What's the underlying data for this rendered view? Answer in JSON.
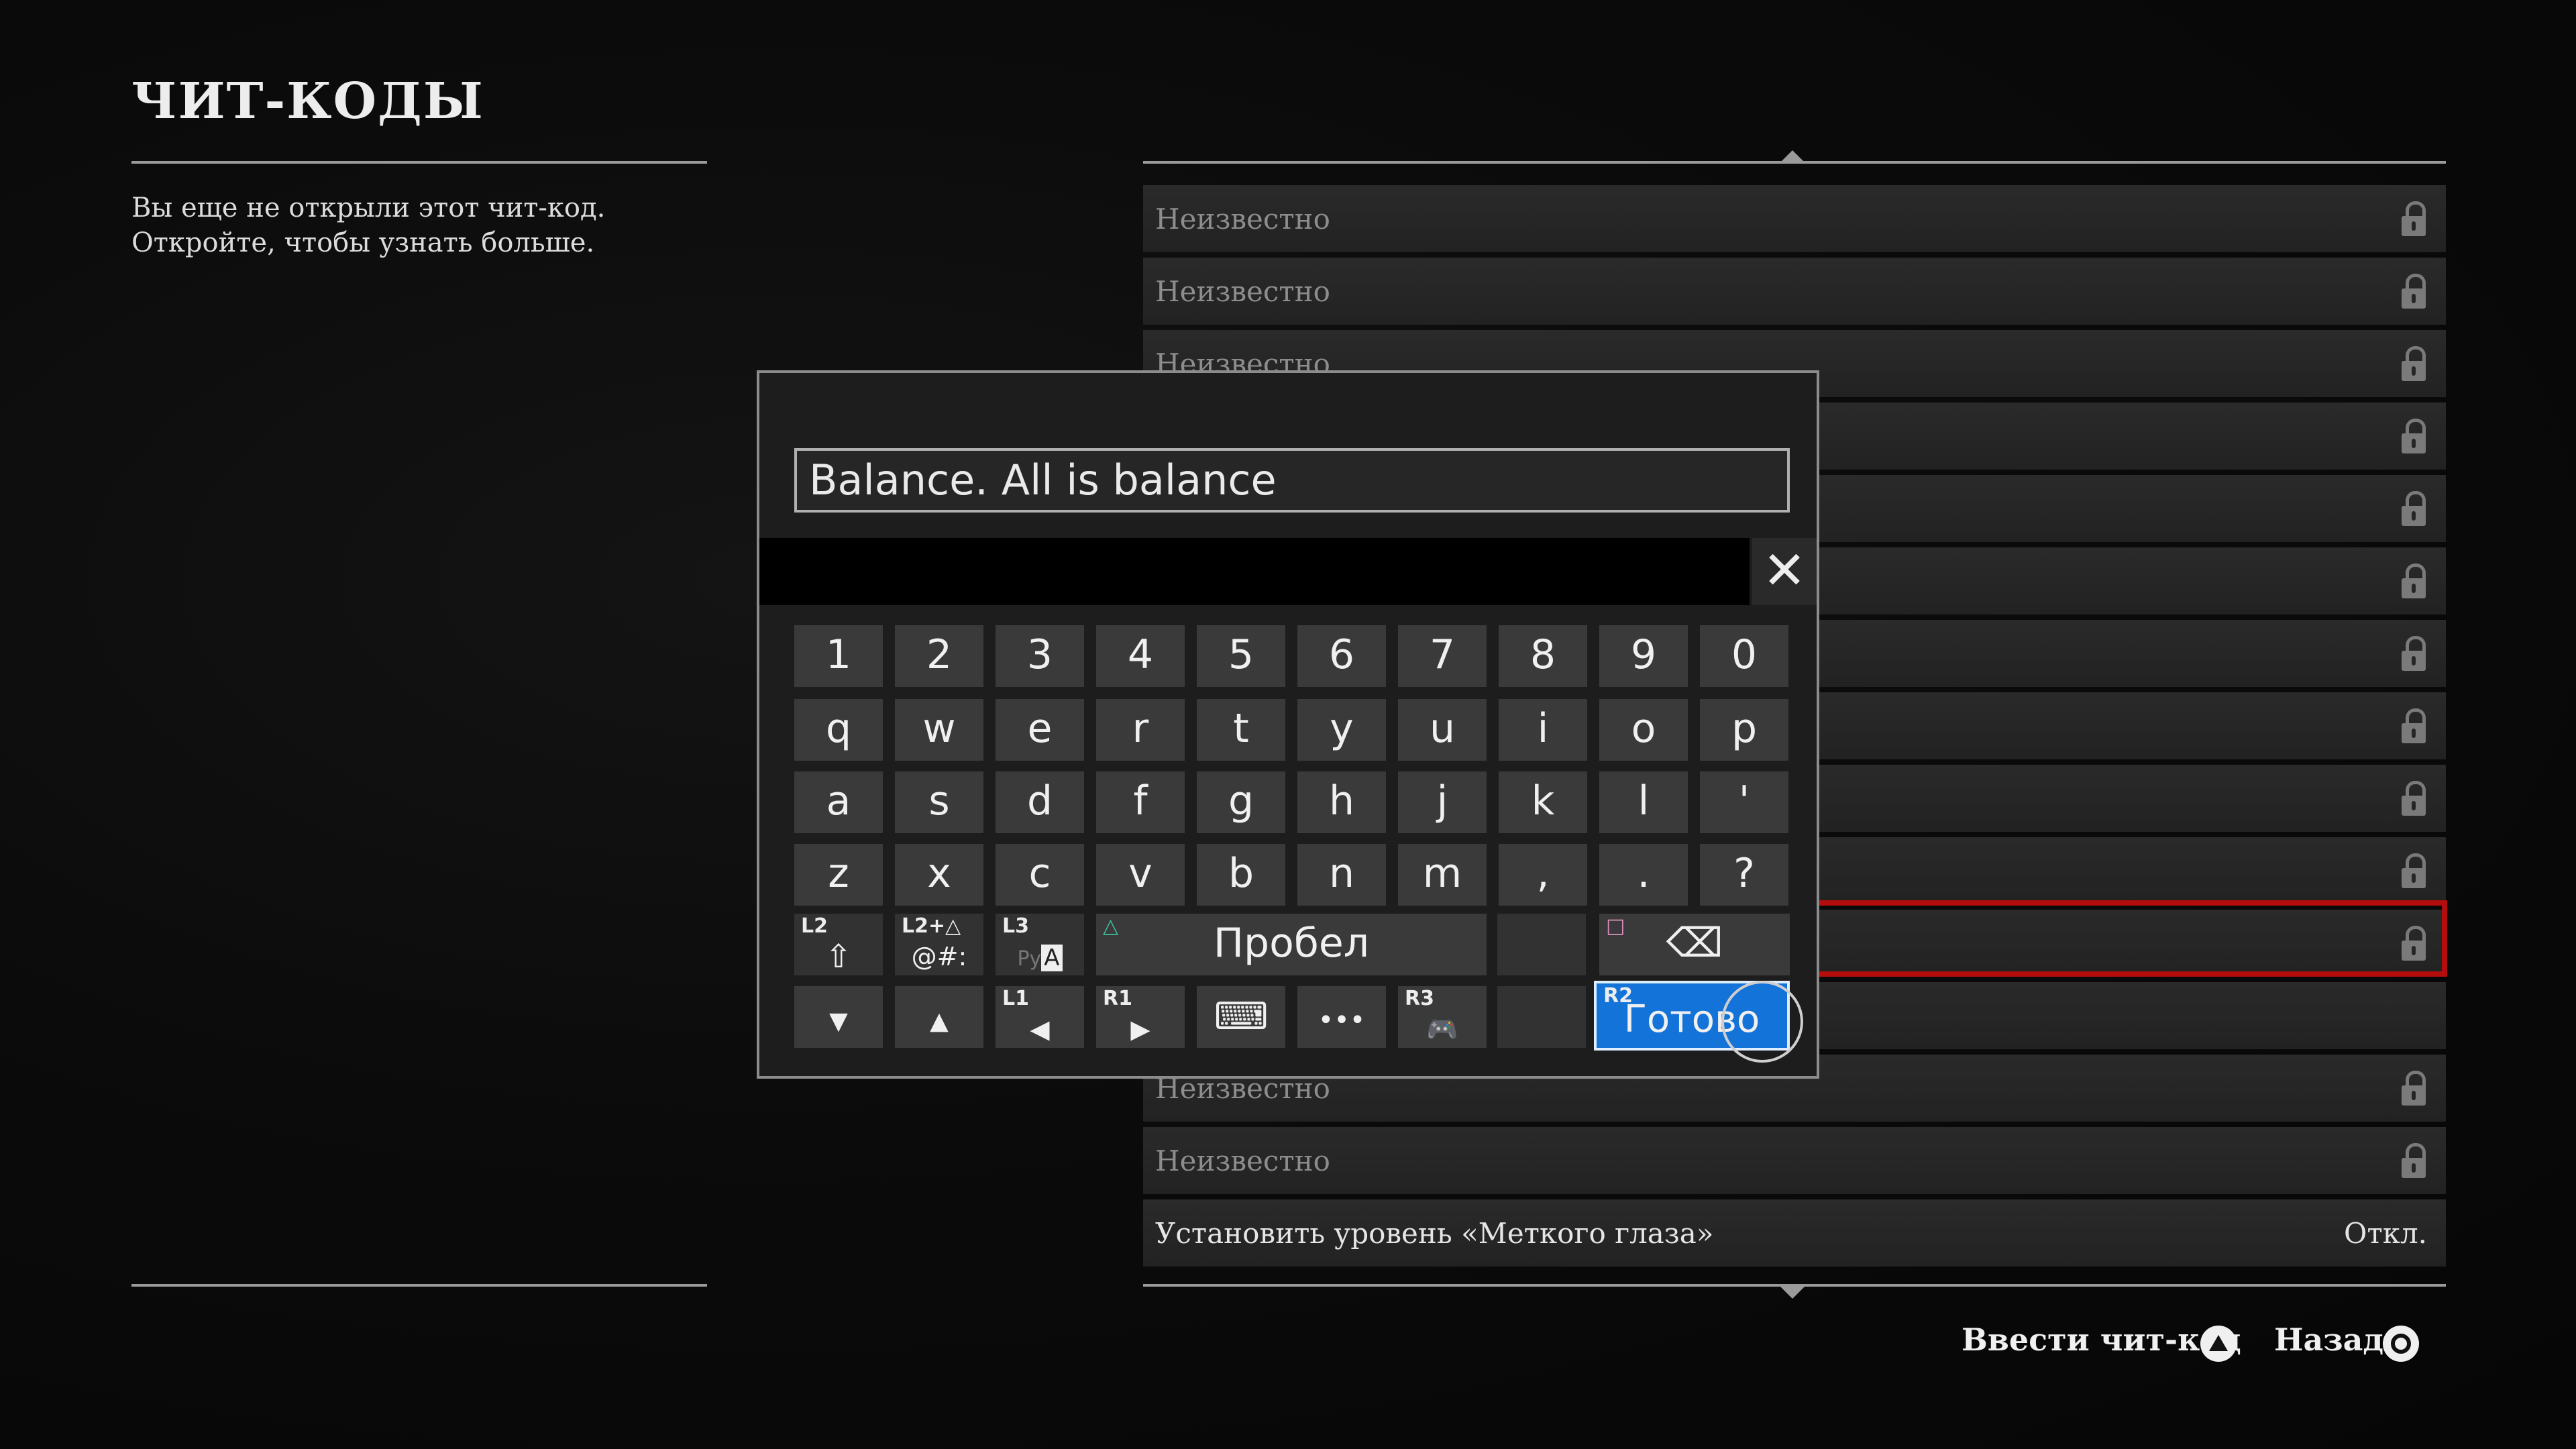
{
  "page": {
    "title": "ЧИТ-КОДЫ",
    "description_line1": "Вы еще не открыли этот чит-код.",
    "description_line2": "Откройте, чтобы узнать больше."
  },
  "cheat_list": {
    "rows": [
      {
        "label": "Неизвестно",
        "locked": true
      },
      {
        "label": "Неизвестно",
        "locked": true
      },
      {
        "label": "Неизвестно",
        "locked": true
      },
      {
        "label": "",
        "locked": true
      },
      {
        "label": "",
        "locked": true
      },
      {
        "label": "",
        "locked": true
      },
      {
        "label": "",
        "locked": true
      },
      {
        "label": "",
        "locked": true
      },
      {
        "label": "",
        "locked": true
      },
      {
        "label": "",
        "locked": true
      },
      {
        "label": "",
        "locked": true,
        "selected": true
      },
      {
        "label": "",
        "locked": false
      },
      {
        "label": "Неизвестно",
        "locked": true
      },
      {
        "label": "Неизвестно",
        "locked": true
      },
      {
        "label": "Установить уровень «Меткого глаза»",
        "value": "Откл.",
        "locked": false
      }
    ],
    "selected_color": "#b30d0d"
  },
  "keyboard": {
    "input_value": "Balance. All is balance",
    "close_glyph": "✕",
    "rows": [
      [
        "1",
        "2",
        "3",
        "4",
        "5",
        "6",
        "7",
        "8",
        "9",
        "0"
      ],
      [
        "q",
        "w",
        "e",
        "r",
        "t",
        "y",
        "u",
        "i",
        "o",
        "p"
      ],
      [
        "a",
        "s",
        "d",
        "f",
        "g",
        "h",
        "j",
        "k",
        "l",
        "'"
      ],
      [
        "z",
        "x",
        "c",
        "v",
        "b",
        "n",
        "m",
        ",",
        ".",
        "?"
      ]
    ],
    "function_keys": {
      "shift": {
        "tag": "L2",
        "glyph": "⇧"
      },
      "symbols": {
        "tag": "L2+△",
        "label": "@#:"
      },
      "layout": {
        "tag": "L3",
        "faded": "Ру",
        "label": "A"
      },
      "space": {
        "tag": "△",
        "label": "Пробел"
      },
      "backspace": {
        "tag": "□",
        "glyph": "⌫"
      },
      "down": {
        "glyph": "▼"
      },
      "up": {
        "glyph": "▲"
      },
      "left": {
        "tag": "L1",
        "glyph": "◀"
      },
      "right": {
        "tag": "R1",
        "glyph": "▶"
      },
      "keyboard_icon": {
        "glyph": "⌨"
      },
      "more": {
        "glyph": "•••"
      },
      "controller": {
        "tag": "R3",
        "glyph": "🎮"
      },
      "done": {
        "tag": "R2",
        "label": "Готово"
      }
    },
    "done_color": "#1373d8"
  },
  "footer": {
    "enter_code_label": "Ввести чит-код",
    "back_label": "Назад"
  }
}
